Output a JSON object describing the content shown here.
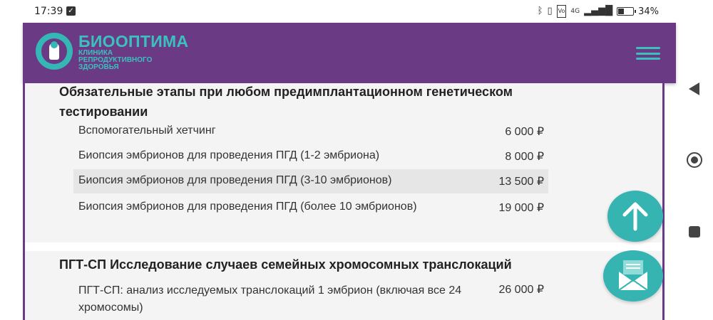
{
  "status_bar": {
    "time": "17:39",
    "network": "4G",
    "battery": "34",
    "battery_level": 0.34
  },
  "header": {
    "logo_title": "БИООПТИМА",
    "logo_subtitle": "КЛИНИКА РЕПРОДУКТИВНОГО ЗДОРОВЬЯ",
    "menu_icon": "hamburger-menu-icon",
    "bg_color": "#6a3a85",
    "accent_color": "#3cc0bd"
  },
  "sections": [
    {
      "title": "Обязательные этапы при любом предимплантационном генетическом тестировании",
      "items": [
        {
          "name": "Вспомогательный хетчинг",
          "price": "6 000 ₽"
        },
        {
          "name": "Биопсия эмбрионов для проведения ПГД (1-2 эмбриона)",
          "price": "8 000 ₽"
        },
        {
          "name": "Биопсия эмбрионов для проведения ПГД (3-10 эмбрионов)",
          "price": "13 500 ₽"
        },
        {
          "name": "Биопсия эмбрионов для проведения ПГД (более 10 эмбрионов)",
          "price": "19 000 ₽"
        }
      ]
    },
    {
      "title": "ПГТ-СП Исследование случаев семейных хромосомных транслокаций",
      "items": [
        {
          "name": "ПГТ-СП: анализ исследуемых транслокаций 1 эмбрион (включая все 24 хромосомы)",
          "price": "26 000 ₽"
        }
      ]
    }
  ],
  "fabs": {
    "scroll_top_icon": "arrow-up-icon",
    "contact_icon": "envelope-icon"
  },
  "system_nav": {
    "back_icon": "back-triangle-icon",
    "home_icon": "home-circle-icon",
    "recents_icon": "recents-square-icon"
  }
}
